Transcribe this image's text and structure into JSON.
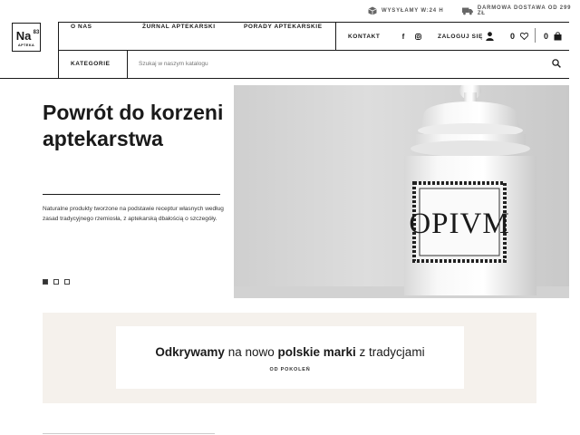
{
  "topbar": {
    "shipping_label": "WYSYŁAMY W:24 H",
    "free_delivery_label": "DARMOWA DOSTAWA OD 299 ZŁ"
  },
  "logo": {
    "symbol": "Na",
    "number": "83",
    "sub": "APTEKA"
  },
  "nav": {
    "items": [
      "O NAS",
      "ŻURNAL APTEKARSKI",
      "PORADY APTEKARSKIE"
    ],
    "contact": "KONTAKT",
    "login": "ZALOGUJ SIĘ",
    "wishlist_count": "0",
    "cart_count": "0",
    "categories": "KATEGORIE",
    "search_placeholder": "Szukaj w naszym katalogu"
  },
  "hero": {
    "title": "Powrót do korzeni aptekarstwa",
    "text": "Naturalne produkty tworzone na podstawie receptur własnych według zasad tradycyjnego rzemiosła, z aptekarską dbałością o szczegóły.",
    "jar_label": "OPIVM",
    "slides": 3,
    "active_slide": 1
  },
  "brands": {
    "w1": "Odkrywamy",
    "w2": " na nowo ",
    "w3": "polskie marki",
    "w4": " z tradycjami",
    "sub": "OD POKOLEŃ"
  }
}
